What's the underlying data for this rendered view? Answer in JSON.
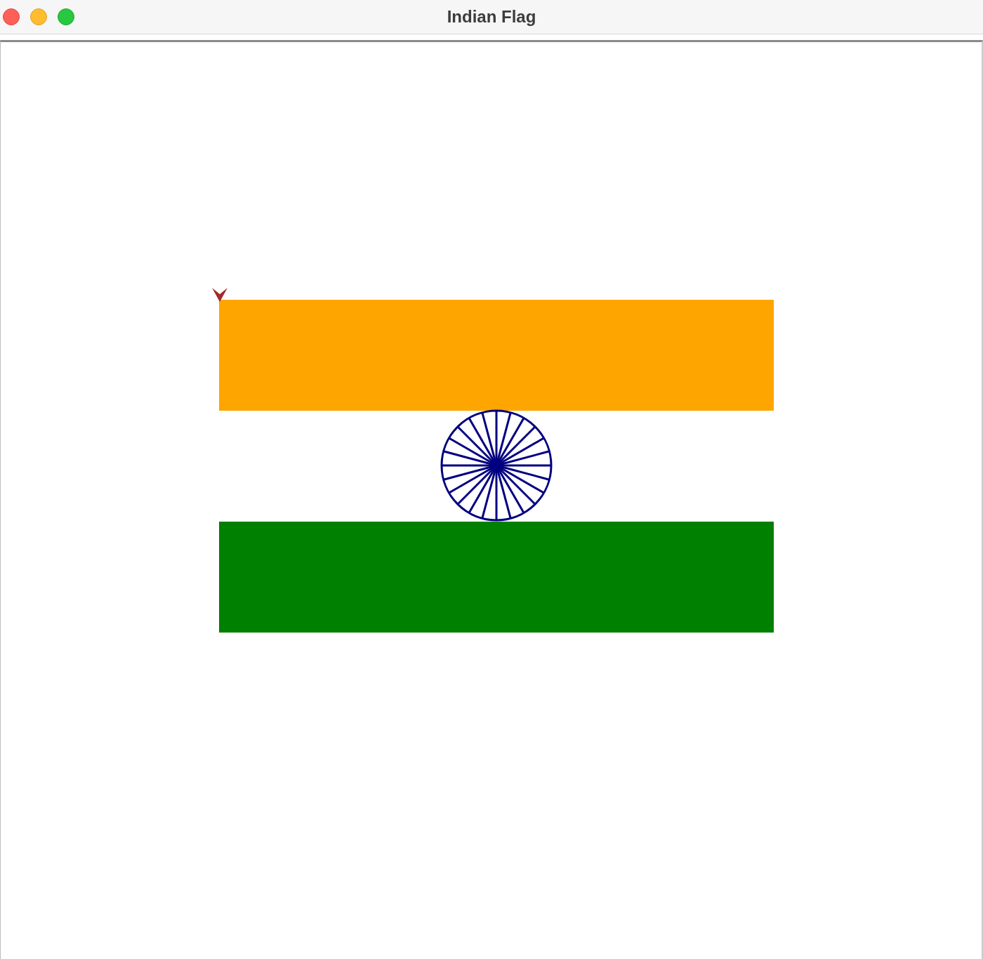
{
  "window": {
    "title": "Indian Flag"
  },
  "canvas": {
    "flag_stripes": [
      {
        "color": "#ffa500"
      },
      {
        "color": "#ffffff"
      },
      {
        "color": "#008000"
      }
    ]
  }
}
